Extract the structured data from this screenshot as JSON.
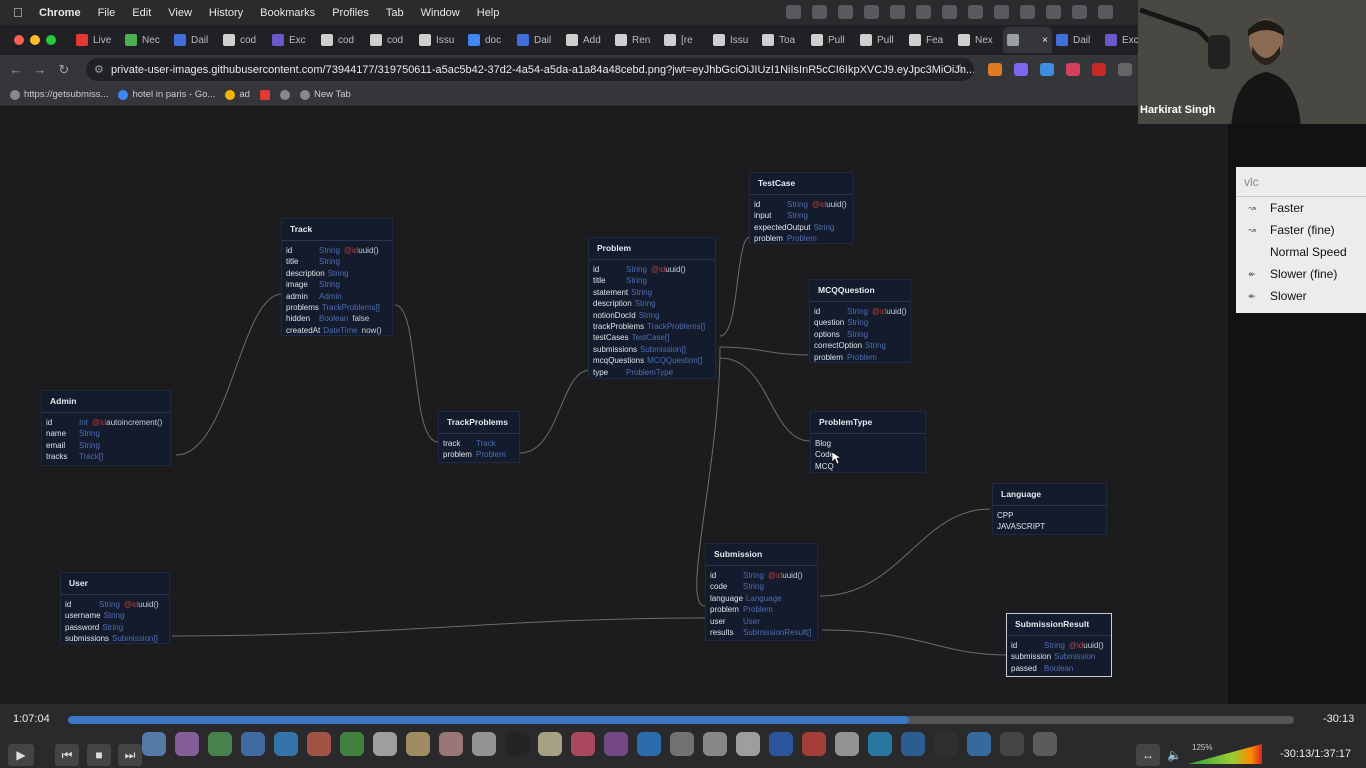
{
  "menubar": {
    "app": "Chrome",
    "items": [
      "File",
      "Edit",
      "View",
      "History",
      "Bookmarks",
      "Profiles",
      "Tab",
      "Window",
      "Help"
    ]
  },
  "tabs": [
    {
      "label": "Live",
      "color": "#e53935"
    },
    {
      "label": "Nec",
      "color": "#4caf50"
    },
    {
      "label": "Dail",
      "color": "#3f6fd8"
    },
    {
      "label": "cod",
      "color": "#cfcfcf"
    },
    {
      "label": "Exc",
      "color": "#6a5acd"
    },
    {
      "label": "cod",
      "color": "#cfcfcf"
    },
    {
      "label": "cod",
      "color": "#cfcfcf"
    },
    {
      "label": "Issu",
      "color": "#cfcfcf"
    },
    {
      "label": "doc",
      "color": "#4285f4"
    },
    {
      "label": "Dail",
      "color": "#3f6fd8"
    },
    {
      "label": "Add",
      "color": "#cfcfcf"
    },
    {
      "label": "Ren",
      "color": "#cfcfcf"
    },
    {
      "label": "[re",
      "color": "#cfcfcf"
    },
    {
      "label": "Issu",
      "color": "#cfcfcf"
    },
    {
      "label": "Toa",
      "color": "#cfcfcf"
    },
    {
      "label": "Pull",
      "color": "#cfcfcf"
    },
    {
      "label": "Pull",
      "color": "#cfcfcf"
    },
    {
      "label": "Fea",
      "color": "#cfcfcf"
    },
    {
      "label": "Nex",
      "color": "#cfcfcf"
    },
    {
      "label": "",
      "color": "#9aa0a6",
      "active": true
    },
    {
      "label": "Dail",
      "color": "#3f6fd8"
    },
    {
      "label": "Exc",
      "color": "#6a5acd"
    }
  ],
  "url": "private-user-images.githubusercontent.com/73944177/319750611-a5ac5b42-37d2-4a54-a5da-a1a84a48cebd.png?jwt=eyJhbGciOiJIUzI1NiIsInR5cCI6IkpXVCJ9.eyJpc3MiOiJn...",
  "bookmarks": [
    {
      "label": "https://getsubmiss...",
      "color": "#888"
    },
    {
      "label": "hotel in paris - Go...",
      "color": "#4285f4"
    },
    {
      "label": "ad",
      "color": "#f4b400"
    },
    {
      "label": "",
      "color": "#e53935"
    },
    {
      "label": "",
      "color": "#888"
    },
    {
      "label": "New Tab",
      "color": "#888"
    }
  ],
  "tables": {
    "track": {
      "title": "Track",
      "fields": [
        {
          "n": "id",
          "t": "String",
          "a": "@id",
          "d": "uuid()"
        },
        {
          "n": "title",
          "t": "String"
        },
        {
          "n": "description",
          "t": "String"
        },
        {
          "n": "image",
          "t": "String"
        },
        {
          "n": "admin",
          "t": "Admin"
        },
        {
          "n": "problems",
          "t": "TrackProblems[]"
        },
        {
          "n": "hidden",
          "t": "Boolean",
          "d": "false"
        },
        {
          "n": "createdAt",
          "t": "DateTime",
          "d": "now()"
        }
      ]
    },
    "admin": {
      "title": "Admin",
      "fields": [
        {
          "n": "id",
          "t": "Int",
          "a": "@id",
          "d": "autoincrement()"
        },
        {
          "n": "name",
          "t": "String"
        },
        {
          "n": "email",
          "t": "String"
        },
        {
          "n": "tracks",
          "t": "Track[]"
        }
      ]
    },
    "trackproblems": {
      "title": "TrackProblems",
      "fields": [
        {
          "n": "track",
          "t": "Track"
        },
        {
          "n": "problem",
          "t": "Problem"
        }
      ]
    },
    "problem": {
      "title": "Problem",
      "fields": [
        {
          "n": "id",
          "t": "String",
          "a": "@id",
          "d": "uuid()"
        },
        {
          "n": "title",
          "t": "String"
        },
        {
          "n": "statement",
          "t": "String"
        },
        {
          "n": "description",
          "t": "String"
        },
        {
          "n": "notionDocId",
          "t": "String"
        },
        {
          "n": "trackProblems",
          "t": "TrackProblems[]"
        },
        {
          "n": "testCases",
          "t": "TestCase[]"
        },
        {
          "n": "submissions",
          "t": "Submission[]"
        },
        {
          "n": "mcqQuestions",
          "t": "MCQQuestion[]"
        },
        {
          "n": "type",
          "t": "ProblemType"
        }
      ]
    },
    "testcase": {
      "title": "TestCase",
      "fields": [
        {
          "n": "id",
          "t": "String",
          "a": "@id",
          "d": "uuid()"
        },
        {
          "n": "input",
          "t": "String"
        },
        {
          "n": "expectedOutput",
          "t": "String"
        },
        {
          "n": "problem",
          "t": "Problem"
        }
      ]
    },
    "mcq": {
      "title": "MCQQuestion",
      "fields": [
        {
          "n": "id",
          "t": "String",
          "a": "@id",
          "d": "uuid()"
        },
        {
          "n": "question",
          "t": "String"
        },
        {
          "n": "options",
          "t": "String"
        },
        {
          "n": "correctOption",
          "t": "String"
        },
        {
          "n": "problem",
          "t": "Problem"
        }
      ]
    },
    "problemtype": {
      "title": "ProblemType",
      "fields": [
        {
          "n": "Blog"
        },
        {
          "n": "Code"
        },
        {
          "n": "MCQ"
        }
      ]
    },
    "language": {
      "title": "Language",
      "fields": [
        {
          "n": "CPP"
        },
        {
          "n": "JAVASCRIPT"
        }
      ]
    },
    "submission": {
      "title": "Submission",
      "fields": [
        {
          "n": "id",
          "t": "String",
          "a": "@id",
          "d": "uuid()"
        },
        {
          "n": "code",
          "t": "String"
        },
        {
          "n": "language",
          "t": "Language"
        },
        {
          "n": "problem",
          "t": "Problem"
        },
        {
          "n": "user",
          "t": "User"
        },
        {
          "n": "results",
          "t": "SubmissionResult[]"
        }
      ]
    },
    "user": {
      "title": "User",
      "fields": [
        {
          "n": "id",
          "t": "String",
          "a": "@id",
          "d": "uuid()"
        },
        {
          "n": "username",
          "t": "String"
        },
        {
          "n": "password",
          "t": "String"
        },
        {
          "n": "submissions",
          "t": "Submission[]"
        }
      ]
    },
    "submissionresult": {
      "title": "SubmissionResult",
      "fields": [
        {
          "n": "id",
          "t": "String",
          "a": "@id",
          "d": "uuid()"
        },
        {
          "n": "submission",
          "t": "Submission"
        },
        {
          "n": "passed",
          "t": "Boolean"
        }
      ]
    }
  },
  "webcam": {
    "name": "Harkirat Singh"
  },
  "speedmenu": {
    "search_placeholder": "vlc",
    "items": [
      {
        "label": "Faster",
        "icon": "fast-forward-icon"
      },
      {
        "label": "Faster (fine)",
        "icon": "fast-forward-icon"
      },
      {
        "label": "Normal Speed",
        "icon": ""
      },
      {
        "label": "Slower (fine)",
        "icon": "rewind-icon"
      },
      {
        "label": "Slower",
        "icon": "rewind-icon"
      }
    ]
  },
  "player": {
    "elapsed": "1:07:04",
    "remaining": "-30:13",
    "progress_fraction": 0.686,
    "volume_label": "125%",
    "time_total": "-30:13/1:37:17"
  },
  "colors": {
    "accent": "#3a78c4",
    "type": "#4f6db2",
    "attribute": "#b3413d",
    "table_bg": "#141b2c"
  }
}
